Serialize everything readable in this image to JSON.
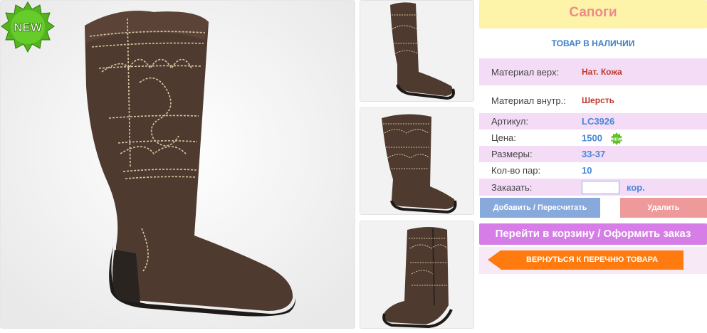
{
  "product": {
    "title": "Сапоги",
    "stock_status": "ТОВАР В НАЛИЧИИ",
    "new_badge": "NEW",
    "new_badge_color": "#4caf2a"
  },
  "details": {
    "material_upper_label": "Материал верх:",
    "material_upper_value": "Нат. Кожа",
    "material_inner_label": "Материал внутр.:",
    "material_inner_value": "Шерсть",
    "article_label": "Артикул:",
    "article_value": "LC3926",
    "price_label": "Цена:",
    "price_value": "1500",
    "sizes_label": "Размеры:",
    "sizes_value": "33-37",
    "pairs_label": "Кол-во пар:",
    "pairs_value": "10",
    "order_label": "Заказать:",
    "order_value": "",
    "order_unit": "кор."
  },
  "actions": {
    "add_label": "Добавить / Пересчитать",
    "delete_label": "Удалить",
    "cart_label": "Перейти в корзину / Оформить заказ",
    "back_label": "ВЕРНУТЬСЯ К ПЕРЕЧНЮ ТОВАРА"
  },
  "colors": {
    "title_bg": "#fdf3a9",
    "title_text": "#f08a8a",
    "row_pink": "#f4dcf6",
    "add_button": "#88a9dc",
    "delete_button": "#ee9a9a",
    "cart_button": "#d67de8",
    "back_button": "#ff7a0f",
    "boot": "#4e3a2f"
  }
}
